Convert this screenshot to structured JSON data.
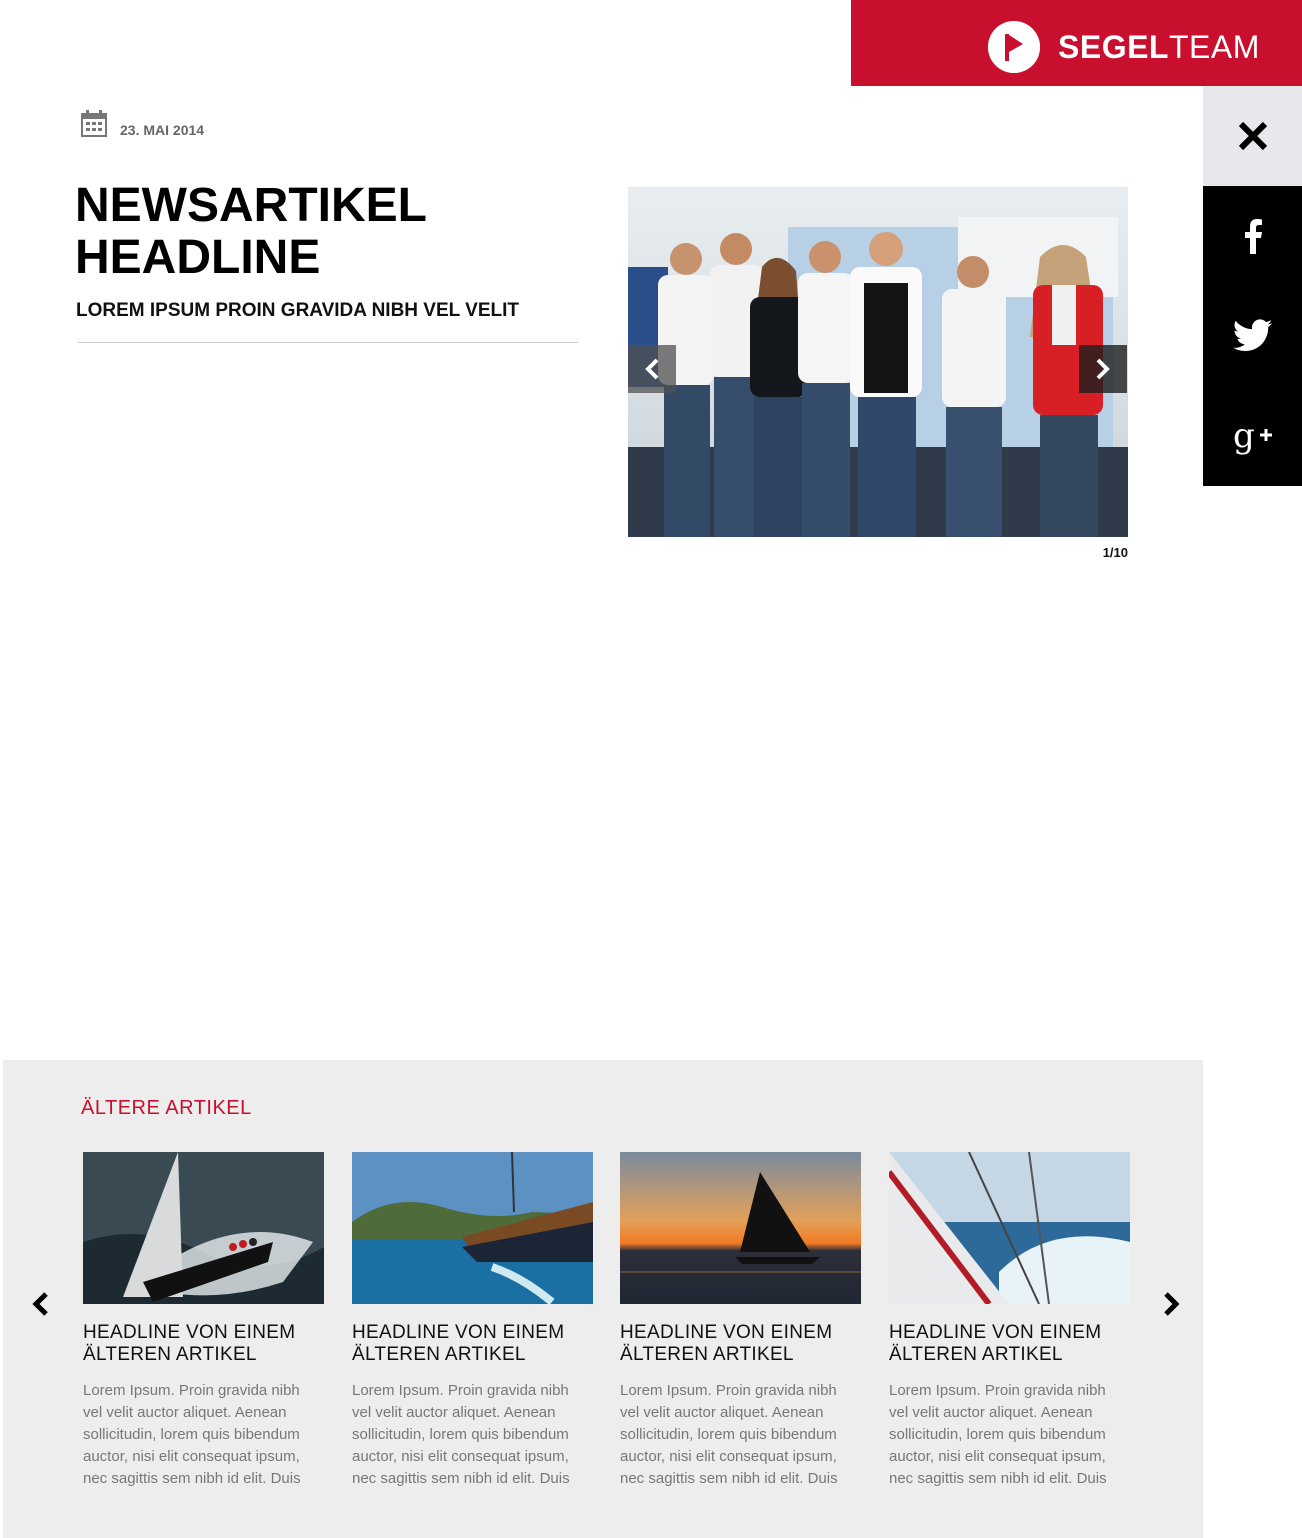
{
  "brand": {
    "name_bold": "SEGEL",
    "name_light": "TEAM",
    "color": "#c8102e"
  },
  "share": {
    "close_icon": "close-icon",
    "facebook_icon": "facebook-icon",
    "twitter_icon": "twitter-icon",
    "googleplus_icon": "google-plus-icon"
  },
  "article": {
    "date": "23. MAI 2014",
    "headline": "NEWSARTIKEL HEADLINE",
    "subheadline": "LOREM IPSUM PROIN GRAVIDA NIBH VEL VELIT"
  },
  "slider": {
    "counter": "1/10",
    "current": 1,
    "total": 10
  },
  "older": {
    "title": "ÄLTERE ARTIKEL",
    "cards": [
      {
        "headline": "HEADLINE VON EINEM ÄLTEREN ARTIKEL",
        "text": "Lorem Ipsum. Proin gravida nibh vel velit auctor aliquet. Aenean sollicitudin, lorem quis bibendum auctor, nisi elit consequat ipsum, nec sagittis sem nibh id elit. Duis"
      },
      {
        "headline": "HEADLINE VON EINEM ÄLTEREN ARTIKEL",
        "text": "Lorem Ipsum. Proin gravida nibh vel velit auctor aliquet. Aenean sollicitudin, lorem quis bibendum auctor, nisi elit consequat ipsum, nec sagittis sem nibh id elit. Duis"
      },
      {
        "headline": "HEADLINE VON EINEM ÄLTEREN ARTIKEL",
        "text": "Lorem Ipsum. Proin gravida nibh vel velit auctor aliquet. Aenean sollicitudin, lorem quis bibendum auctor, nisi elit consequat ipsum, nec sagittis sem nibh id elit. Duis"
      },
      {
        "headline": "HEADLINE VON EINEM ÄLTEREN ARTIKEL",
        "text": "Lorem Ipsum. Proin gravida nibh vel velit auctor aliquet. Aenean sollicitudin, lorem quis bibendum auctor, nisi elit consequat ipsum, nec sagittis sem nibh id elit. Duis"
      }
    ]
  }
}
